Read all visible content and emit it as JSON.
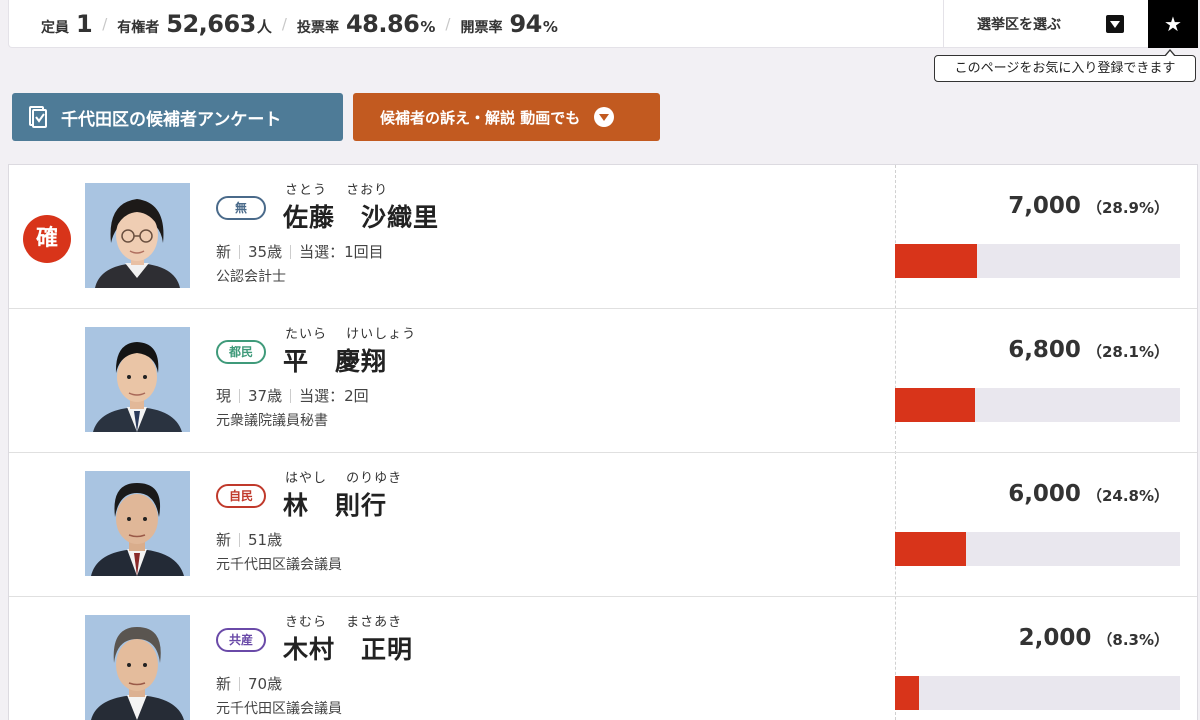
{
  "header": {
    "seats_label": "定員",
    "seats_value": "1",
    "electorate_label": "有権者",
    "electorate_value": "52,663",
    "electorate_unit": "人",
    "turnout_label": "投票率",
    "turnout_value": "48.86",
    "turnout_unit": "%",
    "counted_label": "開票率",
    "counted_value": "94",
    "counted_unit": "%",
    "district_select_label": "選挙区を選ぶ",
    "favorite_icon": "star-icon",
    "favorite_tooltip": "このページをお気に入り登録できます"
  },
  "actions": {
    "survey_button": "千代田区の候補者アンケート",
    "survey_icon": "questionnaire-icon",
    "video_button": "候補者の訴え・解説 動画でも",
    "video_icon": "chevron-down-circle-icon"
  },
  "candidates": [
    {
      "elected_badge": "確",
      "party": "無",
      "party_color": "#4a6a8a",
      "kana": "さとう さおり",
      "name": "佐藤　沙織里",
      "status": "新",
      "age": "35歳",
      "wins": "当選：1回目",
      "career": "公認会計士",
      "votes": "7,000",
      "percent": "（28.9%）",
      "share": 28.9
    },
    {
      "elected_badge": "",
      "party": "都民",
      "party_color": "#3f9a7a",
      "kana": "たいら けいしょう",
      "name": "平　慶翔",
      "status": "現",
      "age": "37歳",
      "wins": "当選：2回",
      "career": "元衆議院議員秘書",
      "votes": "6,800",
      "percent": "（28.1%）",
      "share": 28.1
    },
    {
      "elected_badge": "",
      "party": "自民",
      "party_color": "#c0392b",
      "kana": "はやし のりゆき",
      "name": "林　則行",
      "status": "新",
      "age": "51歳",
      "wins": "",
      "career": "元千代田区議会議員",
      "votes": "6,000",
      "percent": "（24.8%）",
      "share": 24.8
    },
    {
      "elected_badge": "",
      "party": "共産",
      "party_color": "#6a4aa8",
      "kana": "きむら まさあき",
      "name": "木村　正明",
      "status": "新",
      "age": "70歳",
      "wins": "",
      "career": "元千代田区議会議員",
      "votes": "2,000",
      "percent": "（8.3%）",
      "share": 8.3
    }
  ],
  "colors": {
    "bar_fill": "#d8341a",
    "bar_track": "#e9e7ee",
    "survey_button": "#4e7b97",
    "video_button": "#c25a20"
  }
}
